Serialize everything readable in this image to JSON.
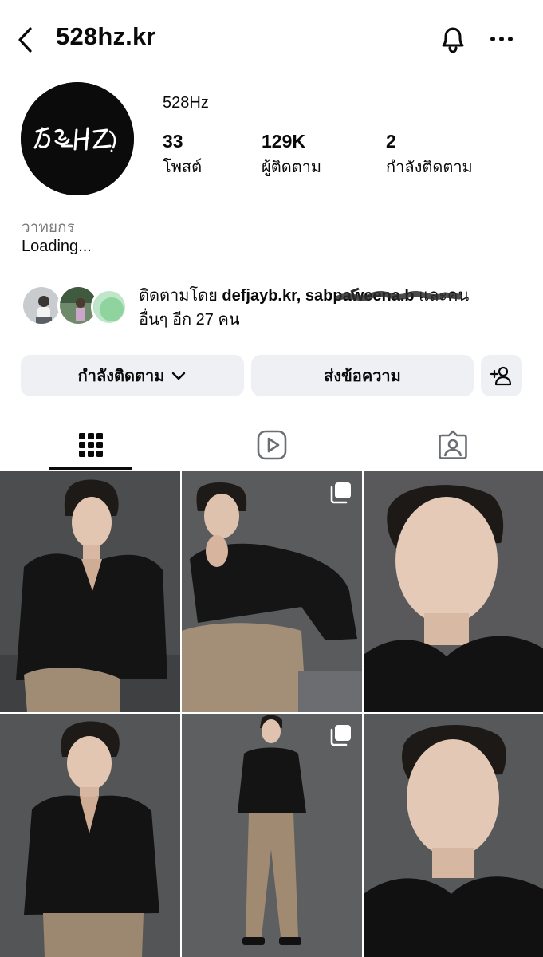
{
  "header": {
    "username": "528hz.kr",
    "back_icon": "chevron-left-icon",
    "bell_icon": "bell-icon",
    "more_icon": "more-horizontal-icon"
  },
  "profile": {
    "display_name": "528Hz",
    "logo_text": "528HZ",
    "stats": [
      {
        "value": "33",
        "label": "โพสต์"
      },
      {
        "value": "129K",
        "label": "ผู้ติดตาม"
      },
      {
        "value": "2",
        "label": "กำลังติดตาม"
      }
    ],
    "category": "วาทยกร",
    "bio": "Loading..."
  },
  "followed_by": {
    "prefix": "ติดตามโดย",
    "user1": "defjayb.kr,",
    "user2": "sabpaweena.b",
    "suffix": "และคน",
    "line2": "อื่นๆ อีก 27 คน"
  },
  "actions": {
    "following_label": "กำลังติดตาม",
    "message_label": "ส่งข้อความ",
    "add_icon": "add-person-icon"
  },
  "tabs": [
    {
      "name": "grid",
      "icon": "grid-icon",
      "active": true
    },
    {
      "name": "reels",
      "icon": "reels-icon",
      "active": false
    },
    {
      "name": "tagged",
      "icon": "tagged-icon",
      "active": false
    }
  ],
  "posts": [
    {
      "kind": "photo",
      "subject": "seated portrait"
    },
    {
      "kind": "carousel",
      "subject": "seated chin-on-hand"
    },
    {
      "kind": "photo",
      "subject": "close-up"
    },
    {
      "kind": "photo",
      "subject": "half-body"
    },
    {
      "kind": "carousel",
      "subject": "full-body standing"
    },
    {
      "kind": "photo",
      "subject": "close-up"
    }
  ]
}
